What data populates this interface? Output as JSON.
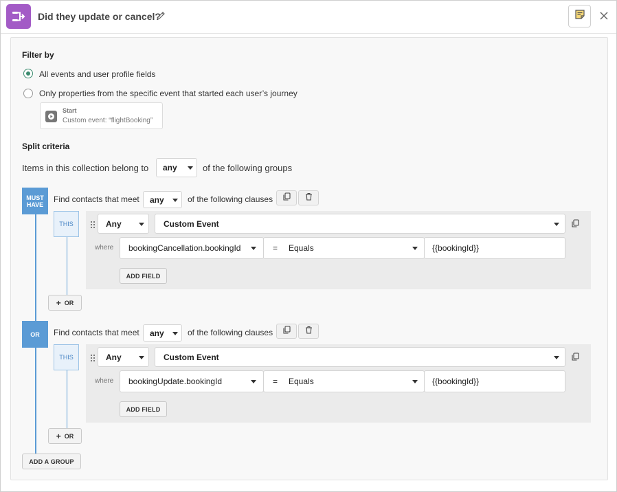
{
  "header": {
    "title": "Did they update or cancel?",
    "icons": {
      "app": "branch-split-icon",
      "edit": "pencil-icon",
      "notes": "note-icon",
      "close": "close-icon"
    },
    "accent": "#a35bc6"
  },
  "filter": {
    "heading": "Filter by",
    "options": [
      {
        "label": "All events and user profile fields",
        "checked": true
      },
      {
        "label": "Only properties from the specific event that started each user’s journey",
        "checked": false
      }
    ],
    "start_card": {
      "title": "Start",
      "subtitle": "Custom event: “flightBooking”"
    }
  },
  "split": {
    "heading": "Split criteria",
    "prefix": "Items in this collection belong to",
    "match": "any",
    "suffix": "of the following groups"
  },
  "groups": [
    {
      "badge": "MUST HAVE",
      "prefix": "Find contacts that meet",
      "match": "any",
      "suffix": "of the following clauses",
      "clause": {
        "this_label": "THIS",
        "quantifier": "Any",
        "event_type": "Custom Event",
        "where_label": "where",
        "field": "bookingCancellation.bookingId",
        "operator_symbol": "=",
        "operator": "Equals",
        "value": "{{bookingId}}",
        "add_field_label": "ADD FIELD"
      },
      "or_label": "OR"
    },
    {
      "badge": "OR",
      "prefix": "Find contacts that meet",
      "match": "any",
      "suffix": "of the following clauses",
      "clause": {
        "this_label": "THIS",
        "quantifier": "Any",
        "event_type": "Custom Event",
        "where_label": "where",
        "field": "bookingUpdate.bookingId",
        "operator_symbol": "=",
        "operator": "Equals",
        "value": "{{bookingId}}",
        "add_field_label": "ADD FIELD"
      },
      "or_label": "OR"
    }
  ],
  "add_group_label": "ADD A GROUP",
  "colors": {
    "group_blue": "#5b9bd5",
    "radio_green": "#3c8b6f"
  }
}
